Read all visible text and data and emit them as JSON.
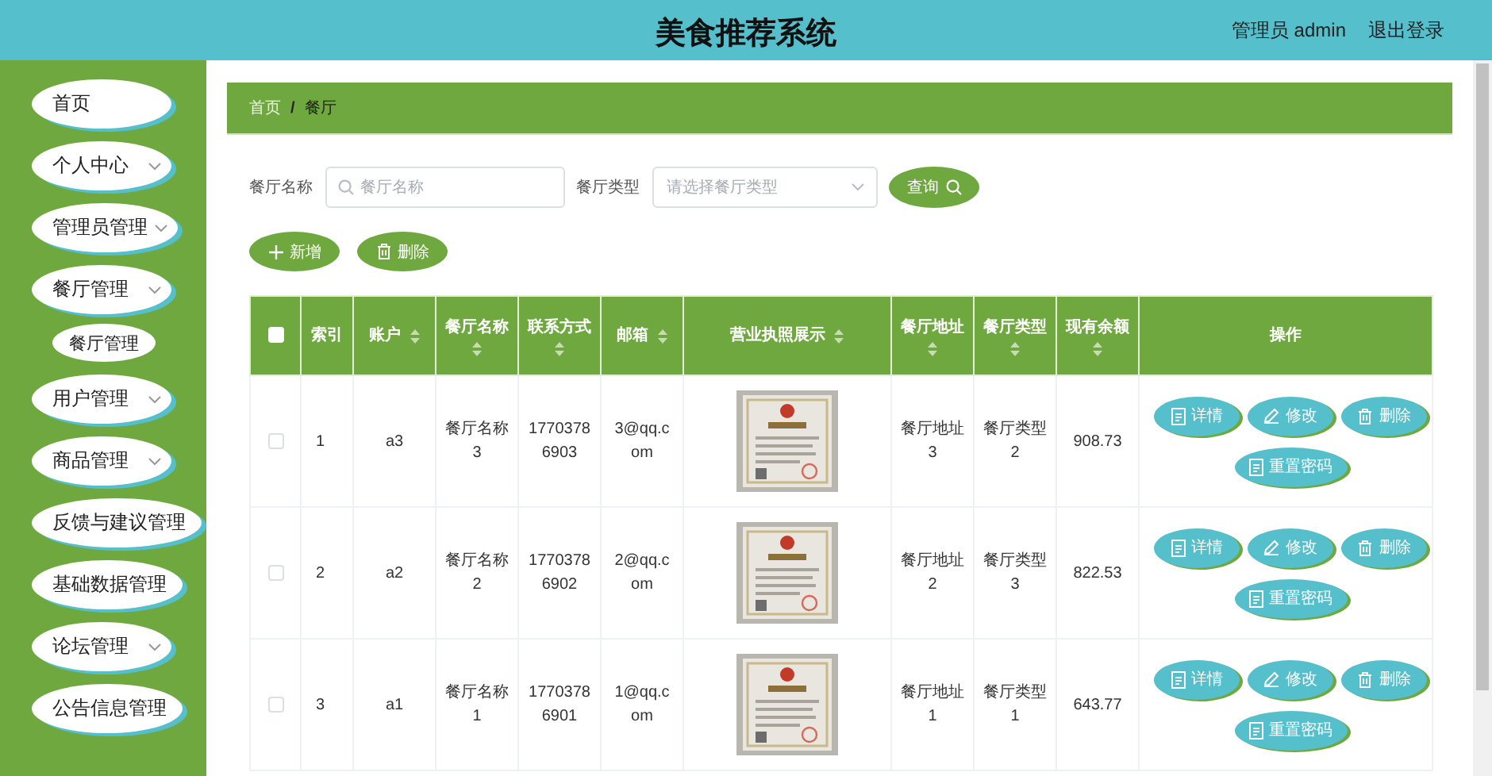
{
  "header": {
    "title": "美食推荐系统",
    "user": "管理员 admin",
    "logout": "退出登录"
  },
  "sidebar": {
    "items": [
      {
        "label": "首页",
        "kind": "link"
      },
      {
        "label": "个人中心",
        "kind": "group"
      },
      {
        "label": "管理员管理",
        "kind": "group"
      },
      {
        "label": "餐厅管理",
        "kind": "group",
        "children": [
          {
            "label": "餐厅管理"
          }
        ]
      },
      {
        "label": "用户管理",
        "kind": "group"
      },
      {
        "label": "商品管理",
        "kind": "group"
      },
      {
        "label": "反馈与建议管理",
        "kind": "link"
      },
      {
        "label": "基础数据管理",
        "kind": "link"
      },
      {
        "label": "论坛管理",
        "kind": "group"
      },
      {
        "label": "公告信息管理",
        "kind": "link"
      }
    ]
  },
  "breadcrumb": {
    "separator": "/",
    "items": [
      {
        "label": "首页",
        "current": false
      },
      {
        "label": "餐厅",
        "current": true
      }
    ]
  },
  "search": {
    "name_label": "餐厅名称",
    "name_placeholder": "餐厅名称",
    "type_label": "餐厅类型",
    "type_placeholder": "请选择餐厅类型",
    "query_button": "查询"
  },
  "toolbar": [
    {
      "label": "新增",
      "kind": "add"
    },
    {
      "label": "删除",
      "kind": "delete"
    }
  ],
  "table": {
    "select_all": {
      "checked": false
    },
    "columns": [
      {
        "label": "索引",
        "sortable": false
      },
      {
        "label": "账户",
        "sortable": true
      },
      {
        "label": "餐厅名称",
        "sortable": true
      },
      {
        "label": "联系方式",
        "sortable": true
      },
      {
        "label": "邮箱",
        "sortable": true
      },
      {
        "label": "营业执照展示",
        "sortable": true
      },
      {
        "label": "餐厅地址",
        "sortable": true
      },
      {
        "label": "餐厅类型",
        "sortable": true
      },
      {
        "label": "现有余额",
        "sortable": true
      },
      {
        "label": "操作",
        "sortable": false
      }
    ],
    "rows": [
      {
        "checked": false,
        "cells": [
          "1",
          "a3",
          "餐厅名称3",
          "17703786903",
          "3@qq.com",
          {
            "kind": "picture"
          },
          "餐厅地址3",
          "餐厅类型2",
          "908.73"
        ],
        "actions": [
          {
            "label": "详情",
            "kind": "detail"
          },
          {
            "label": "修改",
            "kind": "edit"
          },
          {
            "label": "删除",
            "kind": "delete"
          },
          {
            "label": "重置密码",
            "kind": "reset"
          }
        ]
      },
      {
        "checked": false,
        "cells": [
          "2",
          "a2",
          "餐厅名称2",
          "17703786902",
          "2@qq.com",
          {
            "kind": "picture"
          },
          "餐厅地址2",
          "餐厅类型3",
          "822.53"
        ],
        "actions": [
          {
            "label": "详情",
            "kind": "detail"
          },
          {
            "label": "修改",
            "kind": "edit"
          },
          {
            "label": "删除",
            "kind": "delete"
          },
          {
            "label": "重置密码",
            "kind": "reset"
          }
        ]
      },
      {
        "checked": false,
        "cells": [
          "3",
          "a1",
          "餐厅名称1",
          "17703786901",
          "1@qq.com",
          {
            "kind": "picture"
          },
          "餐厅地址1",
          "餐厅类型1",
          "643.77"
        ],
        "actions": [
          {
            "label": "详情",
            "kind": "detail"
          },
          {
            "label": "修改",
            "kind": "edit"
          },
          {
            "label": "删除",
            "kind": "delete"
          },
          {
            "label": "重置密码",
            "kind": "reset"
          }
        ]
      }
    ]
  }
}
